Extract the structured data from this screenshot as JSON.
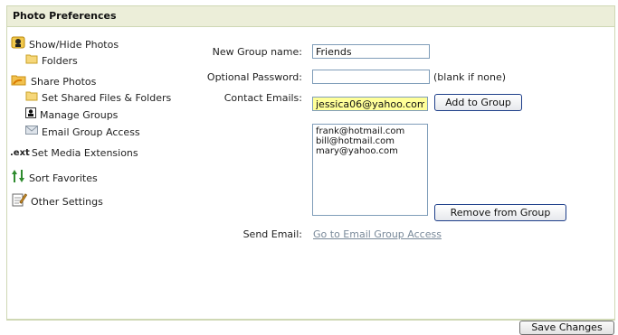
{
  "panel": {
    "title": "Photo Preferences"
  },
  "sidebar": {
    "items": [
      {
        "label": "Show/Hide Photos",
        "icon": "person-card-icon"
      },
      {
        "label": "Folders",
        "icon": "folder-icon"
      },
      {
        "label": "Share Photos",
        "icon": "shared-folder-icon"
      },
      {
        "label": "Set Shared Files & Folders",
        "icon": "folder-icon"
      },
      {
        "label": "Manage Groups",
        "icon": "group-icon",
        "selected": true
      },
      {
        "label": "Email Group Access",
        "icon": "email-icon"
      },
      {
        "label": "Set Media Extensions",
        "icon": "ext-icon",
        "icon_text": ".ext"
      },
      {
        "label": "Sort Favorites",
        "icon": "sort-arrows-icon"
      },
      {
        "label": "Other Settings",
        "icon": "notepad-icon"
      }
    ]
  },
  "form": {
    "group_name_label": "New Group name:",
    "group_name_value": "Friends",
    "password_label": "Optional Password:",
    "password_value": "",
    "password_hint": "(blank if none)",
    "contact_label": "Contact Emails:",
    "contact_value": "jessica06@yahoo.com",
    "add_button": "Add to Group",
    "members": [
      "frank@hotmail.com",
      "bill@hotmail.com",
      "mary@yahoo.com"
    ],
    "remove_button": "Remove from Group",
    "send_email_label": "Send Email:",
    "send_email_link": "Go to Email Group Access"
  },
  "footer": {
    "save_button": "Save Changes"
  },
  "colors": {
    "header_bg": "#eceed9",
    "border": "#cfd8b4",
    "input_highlight": "#ffff99",
    "link": "#7a8a9a"
  }
}
